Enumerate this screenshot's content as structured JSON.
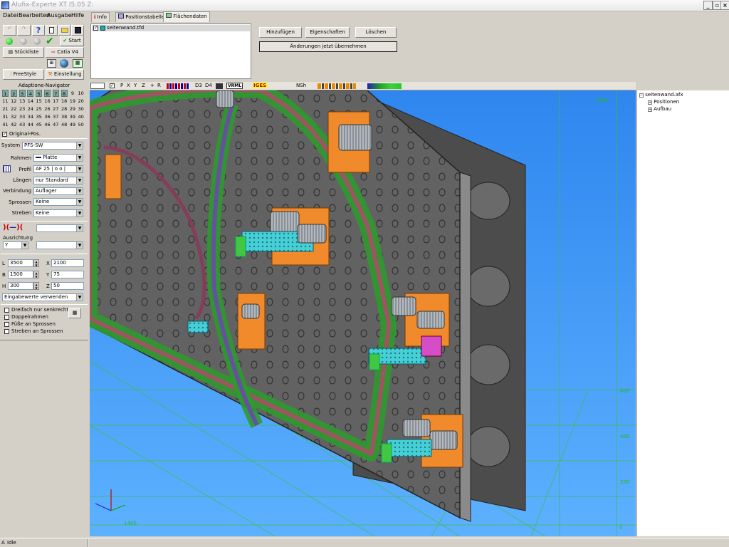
{
  "window": {
    "title": "Alufix-Experte XT I5.05 Z:"
  },
  "menu": [
    "Datei",
    "Bearbeiten",
    "Ausgabe",
    "Hilfe"
  ],
  "tabs": {
    "info": "Info",
    "position": "Positionstabelle",
    "flaechen": "Flächendaten"
  },
  "toolbar": {
    "start": "Start",
    "stueckliste": "Stückliste",
    "catia": "Catia V4",
    "freestyle": "FreeStyle",
    "einstellung": "Einstellung"
  },
  "filelist": {
    "item": "seitenwand.tfd"
  },
  "actions": {
    "add": "Hinzufügen",
    "props": "Eigenschaften",
    "delete": "Löschen",
    "apply": "Änderungen jetzt übernehmen"
  },
  "navigator": {
    "title": "Adaptione-Navigator",
    "rows": [
      [
        "1",
        "2",
        "3",
        "4",
        "5",
        "6",
        "7",
        "8",
        "9",
        "10"
      ],
      [
        "11",
        "12",
        "13",
        "14",
        "15",
        "16",
        "17",
        "18",
        "19",
        "20"
      ],
      [
        "21",
        "22",
        "23",
        "24",
        "25",
        "26",
        "27",
        "28",
        "29",
        "30"
      ],
      [
        "31",
        "32",
        "33",
        "34",
        "35",
        "36",
        "37",
        "38",
        "39",
        "40"
      ],
      [
        "41",
        "42",
        "43",
        "44",
        "45",
        "46",
        "47",
        "48",
        "49",
        "50"
      ]
    ],
    "active_count": 8,
    "original_pos": "Original-Pos."
  },
  "form": {
    "system": {
      "label": "System",
      "value": "PFS-SW"
    },
    "rahmen": {
      "label": "Rahmen",
      "value": "Platte"
    },
    "profil": {
      "label": "Profil",
      "value": "AF 25 | o o |"
    },
    "laengen": {
      "label": "Längen",
      "value": "nur Standard"
    },
    "verbindung": {
      "label": "Verbindung",
      "value": "Auflager"
    },
    "sprossen": {
      "label": "Sprossen",
      "value": "Keine"
    },
    "streben": {
      "label": "Streben",
      "value": "Keine"
    },
    "ausrichtung": {
      "label": "Ausrichtung",
      "value": "Y"
    },
    "dims": [
      {
        "label": "L",
        "value": "3500",
        "label2": "X",
        "value2": "2100"
      },
      {
        "label": "B",
        "value": "1500",
        "label2": "Y",
        "value2": "75"
      },
      {
        "label": "H",
        "value": "300",
        "label2": "Z",
        "value2": "50"
      }
    ],
    "eingabe": "Eingabewerte verwenden",
    "checks": [
      "Dreifach nur senkrecht",
      "Doppelrahmen",
      "Füße an Sprossen",
      "Streben an Sprossen"
    ]
  },
  "viewtoolbar": [
    "P",
    "X",
    "Y",
    "Z",
    "+",
    "R",
    "D3",
    "D4",
    "VRML",
    "IGES",
    "NSh"
  ],
  "tree": {
    "root": "seitenwand.afx",
    "children": [
      "Positionen",
      "Aufbau"
    ]
  },
  "axis_labels": {
    "t1": "1000",
    "t2": "600",
    "t3": "400",
    "t4": "200",
    "t5": "0",
    "bottom": "1400"
  },
  "status": {
    "text": "Idle",
    "prefix": "A"
  },
  "colors": {
    "viewport_bg": "#3d94f0",
    "grid": "#3bbf3b",
    "plate": "#5f5f5f",
    "bracket": "#f08a2a",
    "cylinder": "#40d0d8"
  }
}
